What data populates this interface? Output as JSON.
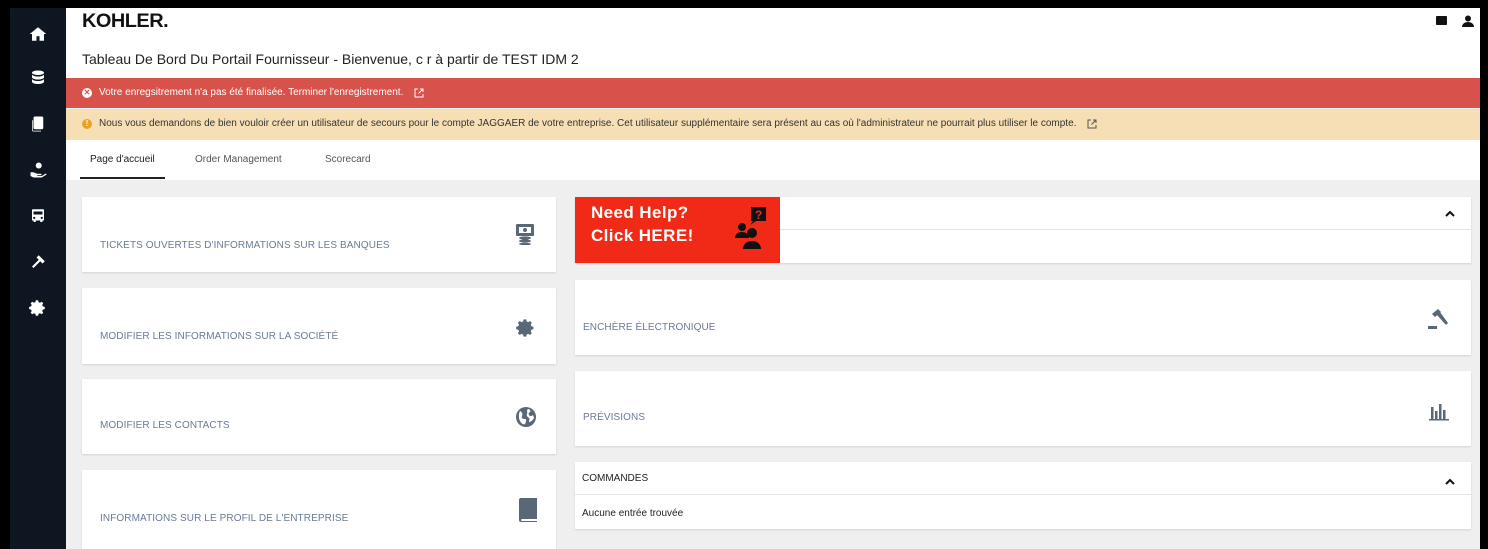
{
  "app": {
    "logo": "KOHLER."
  },
  "header": {
    "title": "Tableau De Bord Du Portail Fournisseur - Bienvenue, c r à partir de TEST IDM 2"
  },
  "sidebar": {
    "items": [
      {
        "name": "home",
        "icon": "home-icon"
      },
      {
        "name": "database",
        "icon": "database-icon"
      },
      {
        "name": "documents",
        "icon": "copy-icon"
      },
      {
        "name": "support",
        "icon": "hand-icon"
      },
      {
        "name": "transport",
        "icon": "truck-icon"
      },
      {
        "name": "tools",
        "icon": "hammer-icon"
      },
      {
        "name": "settings",
        "icon": "gear-icon"
      }
    ]
  },
  "top_icons": [
    "window-icon",
    "user-icon"
  ],
  "alerts": {
    "error": {
      "text": "Votre enregsitrement n'a pas été finalisée. Terminer l'enregistrement.",
      "color": "#d6524a"
    },
    "warning": {
      "text": "Nous vous demandons de bien vouloir créer un utilisateur de secours pour le compte JAGGAER de votre entreprise. Cet utilisateur supplémentaire sera présent au cas où l'administrateur ne pourrait plus utiliser le compte.",
      "color": "#f7dfb5"
    }
  },
  "tabs": [
    {
      "label": "Page d'accueil",
      "active": true
    },
    {
      "label": "Order Management",
      "active": false
    },
    {
      "label": "Scorecard",
      "active": false
    }
  ],
  "cards_left": [
    {
      "label": "TICKETS OUVERTES D'INFORMATIONS SUR LES BANQUES",
      "icon": "money-icon"
    },
    {
      "label": "MODIFIER LES INFORMATIONS SUR LA SOCIÉTÉ",
      "icon": "gear-icon"
    },
    {
      "label": "MODIFIER LES CONTACTS",
      "icon": "globe-icon"
    },
    {
      "label": "INFORMATIONS SUR LE PROFIL DE L'ENTREPRISE",
      "icon": "book-icon"
    }
  ],
  "help_banner": {
    "line1": "Need Help?",
    "line2": "Click HERE!",
    "color": "#f02a16"
  },
  "cards_right": [
    {
      "label": "ENCHÈRE ÉLECTRONIQUE",
      "icon": "gavel-icon"
    },
    {
      "label": "PRÉVISIONS",
      "icon": "bar-chart-icon"
    }
  ],
  "commandes": {
    "title": "COMMANDES",
    "empty_text": "Aucune entrée trouvée"
  }
}
